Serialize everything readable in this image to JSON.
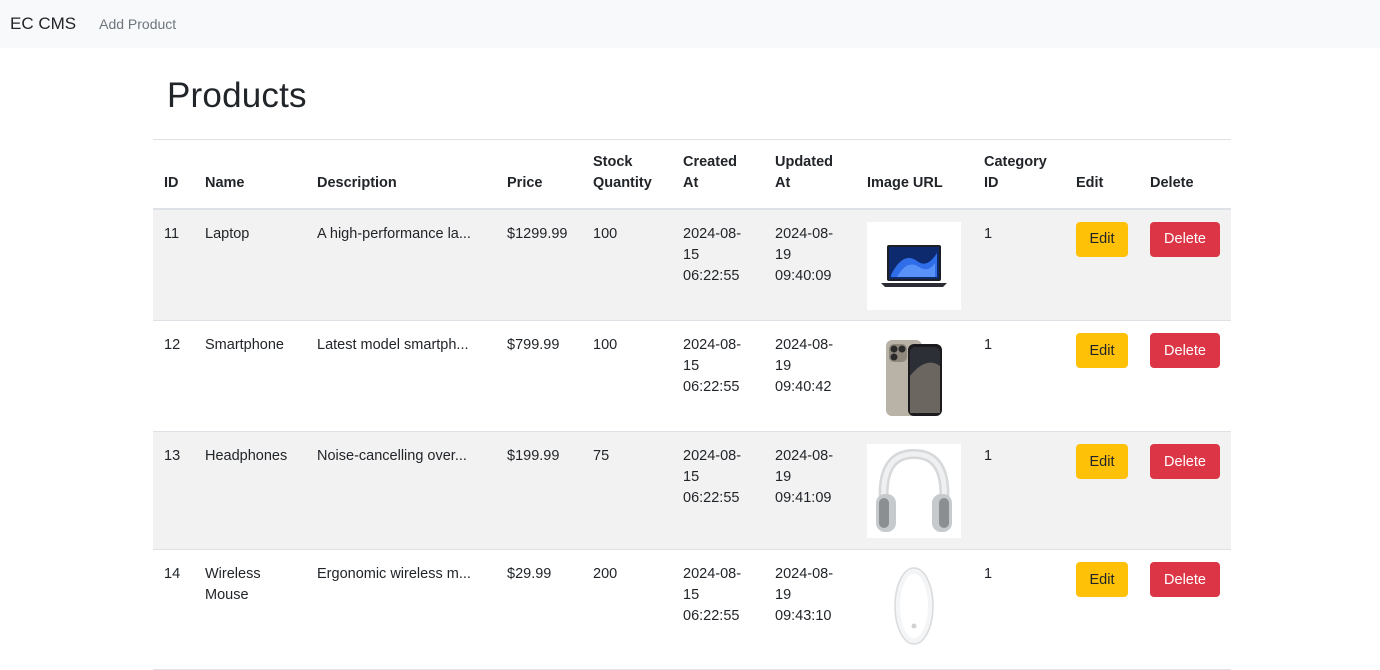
{
  "nav": {
    "brand": "EC CMS",
    "add_product": "Add Product"
  },
  "page": {
    "title": "Products"
  },
  "table": {
    "headers": {
      "id": "ID",
      "name": "Name",
      "description": "Description",
      "price": "Price",
      "stock": "Stock Quantity",
      "created": "Created At",
      "updated": "Updated At",
      "image": "Image URL",
      "category": "Category ID",
      "edit": "Edit",
      "delete": "Delete"
    },
    "rows": [
      {
        "id": "11",
        "name": "Laptop",
        "description": "A high-performance la...",
        "price": "$1299.99",
        "stock": "100",
        "created": "2024-08-15 06:22:55",
        "updated": "2024-08-19 09:40:09",
        "image": "laptop-image",
        "category": "1",
        "edit": "Edit",
        "delete": "Delete"
      },
      {
        "id": "12",
        "name": "Smartphone",
        "description": "Latest model smartph...",
        "price": "$799.99",
        "stock": "100",
        "created": "2024-08-15 06:22:55",
        "updated": "2024-08-19 09:40:42",
        "image": "smartphone-image",
        "category": "1",
        "edit": "Edit",
        "delete": "Delete"
      },
      {
        "id": "13",
        "name": "Headphones",
        "description": "Noise-cancelling over...",
        "price": "$199.99",
        "stock": "75",
        "created": "2024-08-15 06:22:55",
        "updated": "2024-08-19 09:41:09",
        "image": "headphones-image",
        "category": "1",
        "edit": "Edit",
        "delete": "Delete"
      },
      {
        "id": "14",
        "name": "Wireless Mouse",
        "description": "Ergonomic wireless m...",
        "price": "$29.99",
        "stock": "200",
        "created": "2024-08-15 06:22:55",
        "updated": "2024-08-19 09:43:10",
        "image": "mouse-image",
        "category": "1",
        "edit": "Edit",
        "delete": "Delete"
      }
    ]
  },
  "colors": {
    "navbar_bg": "#f8f9fa",
    "edit_btn": "#ffc107",
    "delete_btn": "#dc3545",
    "striped_row": "#f2f2f2"
  }
}
